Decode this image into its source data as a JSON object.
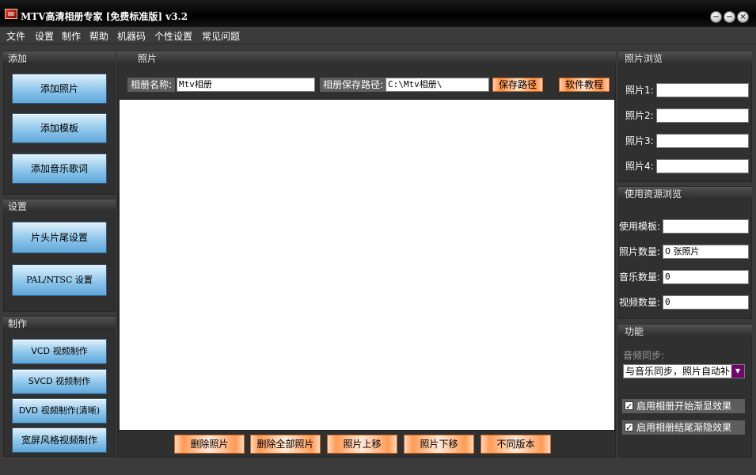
{
  "window": {
    "title": "MTV高清相册专家 [免费标准版] v3.2",
    "controls": [
      "minimize-icon",
      "restore-icon",
      "close-icon"
    ]
  },
  "menu": [
    "文件",
    "设置",
    "制作",
    "帮助",
    "机器码",
    "个性设置",
    "常见问题"
  ],
  "left": {
    "add_header": "添加",
    "add_buttons": [
      "添加照片",
      "添加模板",
      "添加音乐歌词"
    ],
    "settings_header": "设置",
    "settings_buttons": [
      "片头片尾设置",
      "PAL/NTSC 设置"
    ],
    "make_header": "制作",
    "make_buttons": [
      "VCD 视频制作",
      "SVCD 视频制作",
      "DVD 视频制作(清晰)",
      "宽屏风格视频制作"
    ]
  },
  "center": {
    "header": "照片",
    "album_name_label": "相册名称:",
    "album_name_value": "Mtv相册",
    "save_path_label": "相册保存路径:",
    "save_path_value": "C:\\Mtv相册\\",
    "save_path_button": "保存路径",
    "tutorial_button": "软件教程",
    "bottom_buttons": [
      "删除照片",
      "删除全部照片",
      "照片上移",
      "照片下移",
      "不同版本"
    ]
  },
  "right": {
    "photo_browse_header": "照片浏览",
    "photos": [
      {
        "label": "照片1:",
        "value": ""
      },
      {
        "label": "照片2:",
        "value": ""
      },
      {
        "label": "照片3:",
        "value": ""
      },
      {
        "label": "照片4:",
        "value": ""
      }
    ],
    "resources_header": "使用资源浏览",
    "resources": [
      {
        "label": "使用模板:",
        "value": ""
      },
      {
        "label": "照片数量:",
        "value": "0 张照片"
      },
      {
        "label": "音乐数量:",
        "value": "0"
      },
      {
        "label": "视频数量:",
        "value": "0"
      }
    ],
    "function_header": "功能",
    "audio_sync_label": "音频同步:",
    "audio_sync_value": "与音乐同步，照片自动补",
    "checkboxes": [
      "启用相册开始渐显效果",
      "启用相册结尾渐隐效果"
    ]
  },
  "colors": {
    "orange_button": "#ff9a55",
    "blue_button": "#8ec6eb",
    "background": "#3a3a3a",
    "dropdown_arrow": "#6b0a6b"
  }
}
